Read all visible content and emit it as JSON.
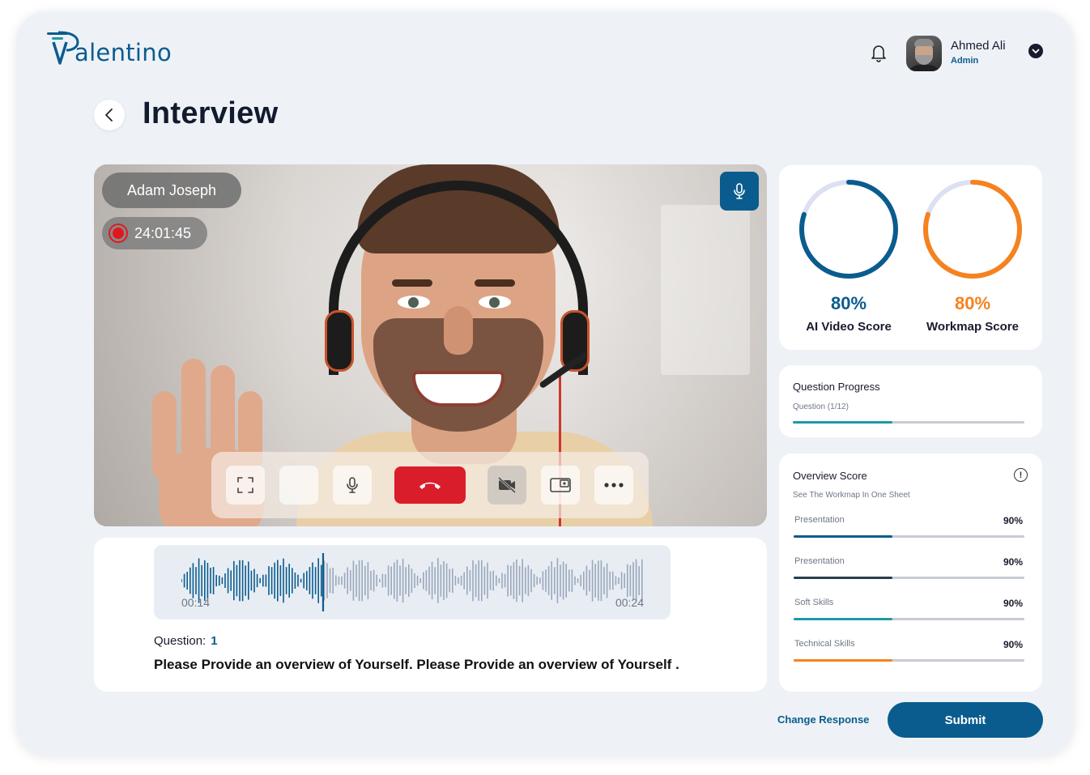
{
  "app": {
    "logo_text": "alentino",
    "brand_color": "#0b5c8e"
  },
  "header": {
    "user_name": "Ahmed Ali",
    "user_role": "Admin",
    "icons": [
      "bell-icon",
      "user-menu-chevron-icon"
    ]
  },
  "page": {
    "title": "Interview",
    "back_icon": "chevron-left-icon"
  },
  "video": {
    "candidate_name": "Adam Joseph",
    "recording_time": "24:01:45",
    "controls": [
      "fullscreen-icon",
      "blank-control",
      "microphone-icon",
      "end-call-icon",
      "video-off-icon",
      "screen-share-icon",
      "more-options-icon"
    ],
    "end_call_color": "#d91d2b"
  },
  "audio": {
    "start_time": "00:14",
    "end_time": "00:24",
    "question_label": "Question:",
    "question_number": "1",
    "question_text": "Please Provide an overview of Yourself. Please Provide an overview of Yourself ."
  },
  "scores": [
    {
      "label": "AI Video Score",
      "value": "80%",
      "fraction": 0.8,
      "color": "#0b5c8e",
      "track": "#dde0f2"
    },
    {
      "label": "Workmap Score",
      "value": "80%",
      "fraction": 0.8,
      "color": "#f5821f",
      "track": "#dde0f2"
    }
  ],
  "question_progress": {
    "title": "Question Progress",
    "subtitle": "Question (1/12)",
    "fraction": 0.4286,
    "color": "#1f9aa6"
  },
  "overview": {
    "title": "Overview Score",
    "subtitle": "See The Workmap In One Sheet",
    "info_icon": "info-icon",
    "metrics": [
      {
        "label": "Presentation",
        "value": "90%",
        "fraction": 0.4286,
        "color": "#0b5c8e"
      },
      {
        "label": "Presentation",
        "value": "90%",
        "fraction": 0.4286,
        "color": "#273f4f"
      },
      {
        "label": "Soft Skills",
        "value": "90%",
        "fraction": 0.4286,
        "color": "#1f9aa6"
      },
      {
        "label": "Technical Skills",
        "value": "90%",
        "fraction": 0.4286,
        "color": "#f5821f"
      }
    ]
  },
  "actions": {
    "change_response": "Change Response",
    "submit": "Submit"
  }
}
